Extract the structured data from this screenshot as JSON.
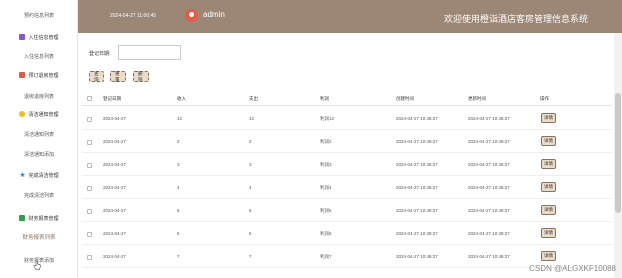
{
  "header": {
    "datetime": "2024-04-27 11:00:45",
    "user": "admin",
    "title": "欢迎使用橙诣酒店客房管理信息系统"
  },
  "sidebar": {
    "items": [
      {
        "label": "预约信息列表",
        "type": "sub"
      },
      {
        "label": "入住信息管理",
        "type": "group",
        "icon": "checkin-icon",
        "color": "#8a57c8"
      },
      {
        "label": "入住信息列表",
        "type": "sub"
      },
      {
        "label": "预订退房管理",
        "type": "group",
        "icon": "checkout-icon",
        "color": "#e05a4a"
      },
      {
        "label": "退房退房列表",
        "type": "sub"
      },
      {
        "label": "清洁通知管理",
        "type": "group",
        "icon": "cleaning-icon",
        "color": "#f0c020"
      },
      {
        "label": "清洁通知列表",
        "type": "sub"
      },
      {
        "label": "清洁通知添加",
        "type": "sub"
      },
      {
        "label": "完成清洁管理",
        "type": "group",
        "icon": "star-icon",
        "color": "#3a7be0"
      },
      {
        "label": "完成清洁列表",
        "type": "sub"
      },
      {
        "label": "财务报表管理",
        "type": "group",
        "icon": "finance-icon",
        "color": "#3a9a4a"
      },
      {
        "label": "财务报表列表",
        "type": "active"
      },
      {
        "label": "财务报表添加",
        "type": "sub"
      }
    ]
  },
  "search": {
    "label": "登记日期:",
    "value": "",
    "placeholder": ""
  },
  "toolbar": {
    "search_label": "查询",
    "reset_label": "重置",
    "delete_label": "删除"
  },
  "table": {
    "columns": [
      "登记日期",
      "收入",
      "支出",
      "利润",
      "创建时间",
      "更新时间",
      "操作"
    ],
    "rows": [
      {
        "date": "2024-04-27",
        "income": "12",
        "expense": "12",
        "profit": "利润12",
        "created": "2024-04-27 10:48:27",
        "updated": "2024-04-27 10:48:27",
        "action": "详情"
      },
      {
        "date": "2024-04-27",
        "income": "2",
        "expense": "2",
        "profit": "利润2",
        "created": "2024-04-27 10:48:27",
        "updated": "2024-04-27 10:48:27",
        "action": "详情"
      },
      {
        "date": "2024-04-27",
        "income": "3",
        "expense": "3",
        "profit": "利润3",
        "created": "2024-04-27 10:48:27",
        "updated": "2024-04-27 10:48:27",
        "action": "详情"
      },
      {
        "date": "2024-04-27",
        "income": "4",
        "expense": "4",
        "profit": "利润4",
        "created": "2024-04-27 10:48:27",
        "updated": "2024-04-27 10:48:27",
        "action": "详情"
      },
      {
        "date": "2024-04-27",
        "income": "5",
        "expense": "5",
        "profit": "利润5",
        "created": "2024-04-27 10:48:27",
        "updated": "2024-04-27 10:48:27",
        "action": "详情"
      },
      {
        "date": "2024-04-27",
        "income": "6",
        "expense": "6",
        "profit": "利润6",
        "created": "2024-04-27 10:48:27",
        "updated": "2024-04-27 10:48:27",
        "action": "详情"
      },
      {
        "date": "2024-04-27",
        "income": "7",
        "expense": "7",
        "profit": "利润7",
        "created": "2024-04-27 10:48:27",
        "updated": "2024-04-27 10:48:27",
        "action": "详情"
      }
    ]
  },
  "watermark": "CSDN @ALGXKF10088",
  "colors": {
    "header_bg": "#9c8676",
    "button_bg": "#e9dcc9",
    "accent": "#8a7060"
  }
}
